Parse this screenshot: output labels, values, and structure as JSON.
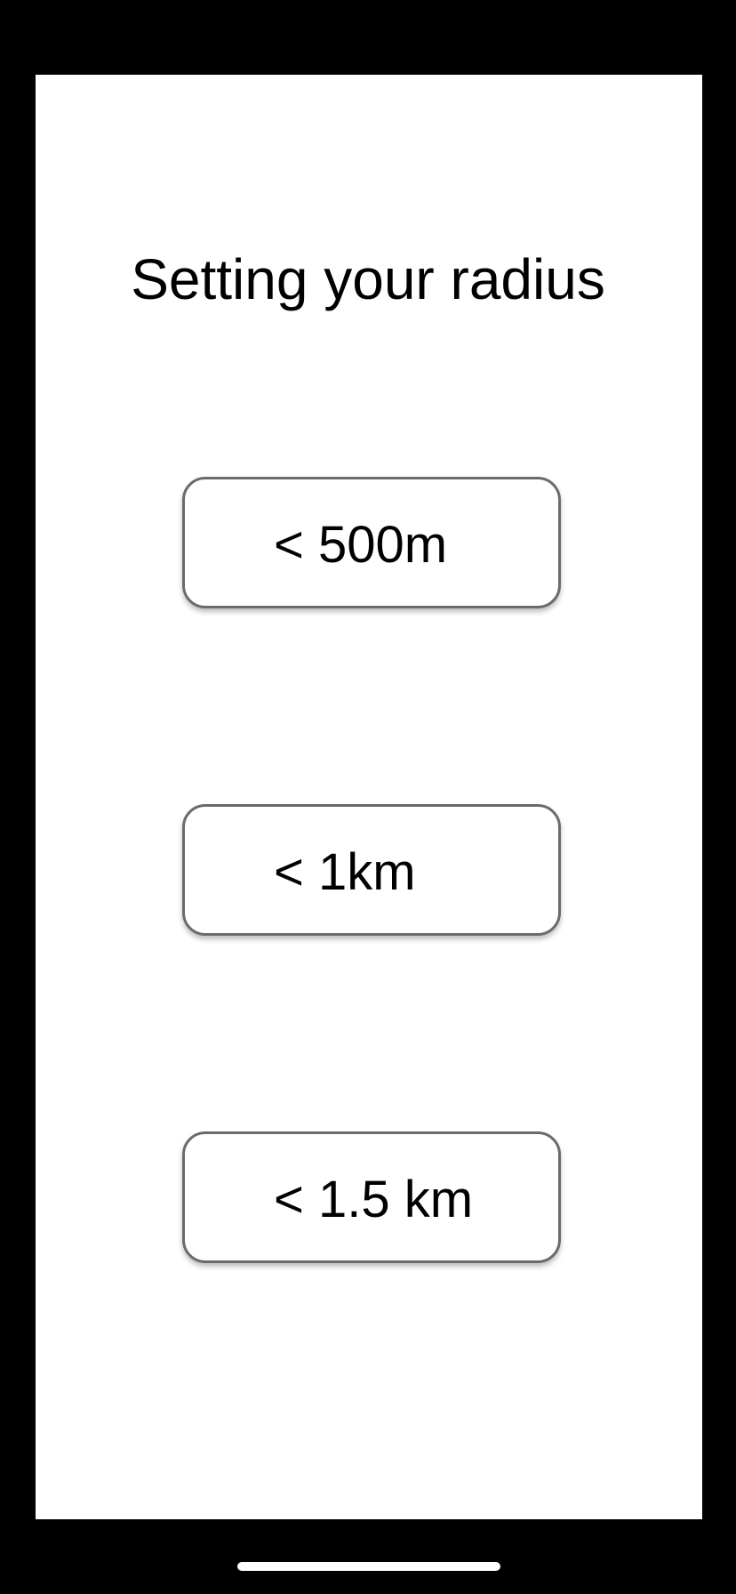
{
  "page": {
    "title": "Setting your radius"
  },
  "options": [
    {
      "label": "< 500m"
    },
    {
      "label": "< 1km"
    },
    {
      "label": "< 1.5 km"
    }
  ],
  "colors": {
    "background": "#000000",
    "screen": "#ffffff",
    "text": "#000000",
    "button_border": "#6b6b6b"
  }
}
